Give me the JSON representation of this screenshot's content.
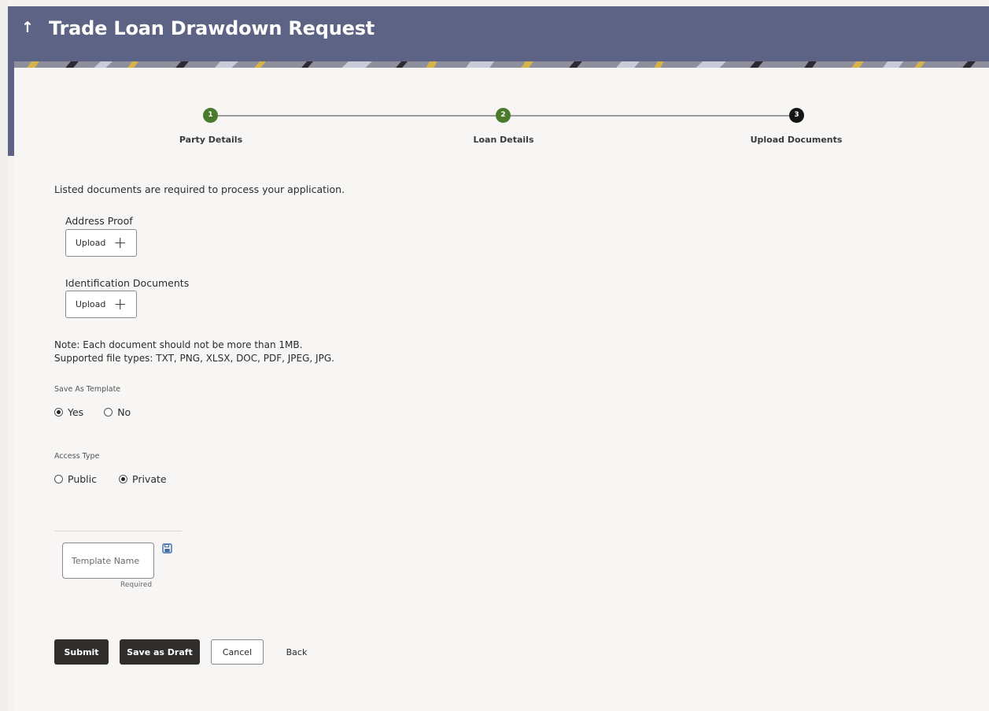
{
  "header": {
    "back_icon": "up-arrow-icon",
    "title": "Trade Loan Drawdown Request"
  },
  "stepper": {
    "steps": [
      {
        "number": "1",
        "label": "Party Details",
        "status": "completed"
      },
      {
        "number": "2",
        "label": "Loan Details",
        "status": "completed"
      },
      {
        "number": "3",
        "label": "Upload Documents",
        "status": "current"
      }
    ]
  },
  "documents": {
    "intro": "Listed documents are required to process your application.",
    "items": [
      {
        "label": "Address Proof",
        "button": "Upload"
      },
      {
        "label": "Identification Documents",
        "button": "Upload"
      }
    ],
    "note_line1": "Note: Each document should not be more than 1MB.",
    "note_line2": "Supported file types: TXT, PNG, XLSX, DOC, PDF, JPEG, JPG."
  },
  "save_as_template": {
    "label": "Save As Template",
    "options": [
      "Yes",
      "No"
    ],
    "selected": "Yes"
  },
  "access_type": {
    "label": "Access Type",
    "options": [
      "Public",
      "Private"
    ],
    "selected": "Private"
  },
  "template": {
    "placeholder": "Template Name",
    "value": "",
    "required_text": "Required",
    "save_icon": "save-icon"
  },
  "actions": {
    "submit": "Submit",
    "save_draft": "Save as Draft",
    "cancel": "Cancel",
    "back": "Back"
  },
  "colors": {
    "header_bg": "#5d6384",
    "step_done": "#4a7a2b",
    "step_current": "#161513",
    "primary_button": "#2f2e2c"
  }
}
